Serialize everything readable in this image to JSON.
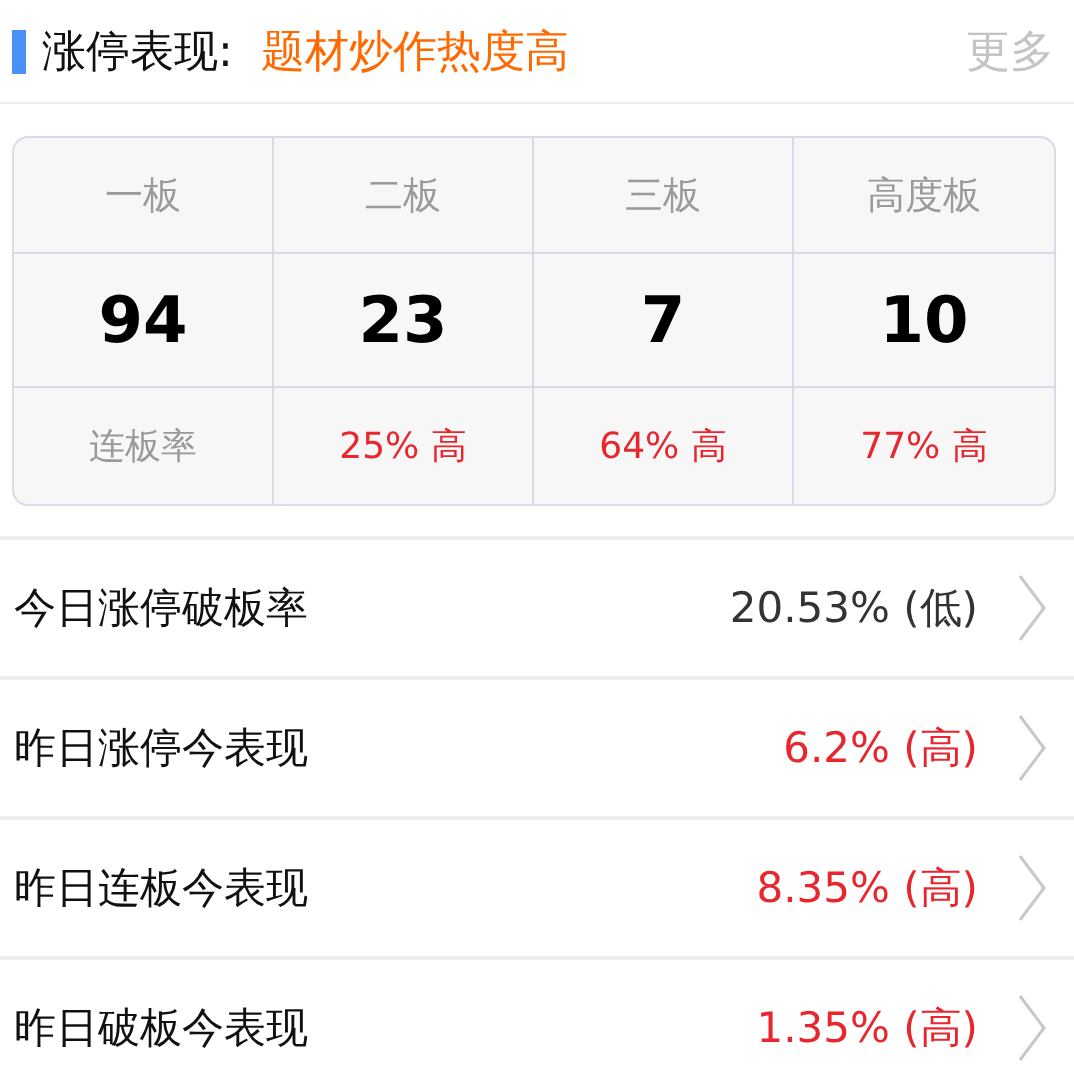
{
  "header": {
    "title": "涨停表现:",
    "highlight": "题材炒作热度高",
    "more": "更多"
  },
  "grid": {
    "columns": [
      {
        "label": "一板",
        "count": "94",
        "rate": "连板率",
        "color": "#999999"
      },
      {
        "label": "二板",
        "count": "23",
        "rate": "25% 高",
        "color": "#e8262d"
      },
      {
        "label": "三板",
        "count": "7",
        "rate": "64% 高",
        "color": "#e8262d"
      },
      {
        "label": "高度板",
        "count": "10",
        "rate": "77% 高",
        "color": "#e8262d"
      }
    ]
  },
  "rows": [
    {
      "label": "今日涨停破板率",
      "value": "20.53% (低)",
      "color": "#333333"
    },
    {
      "label": "昨日涨停今表现",
      "value": "6.2% (高)",
      "color": "#e8262d"
    },
    {
      "label": "昨日连板今表现",
      "value": "8.35% (高)",
      "color": "#e8262d"
    },
    {
      "label": "昨日破板今表现",
      "value": "1.35% (高)",
      "color": "#e8262d"
    }
  ]
}
